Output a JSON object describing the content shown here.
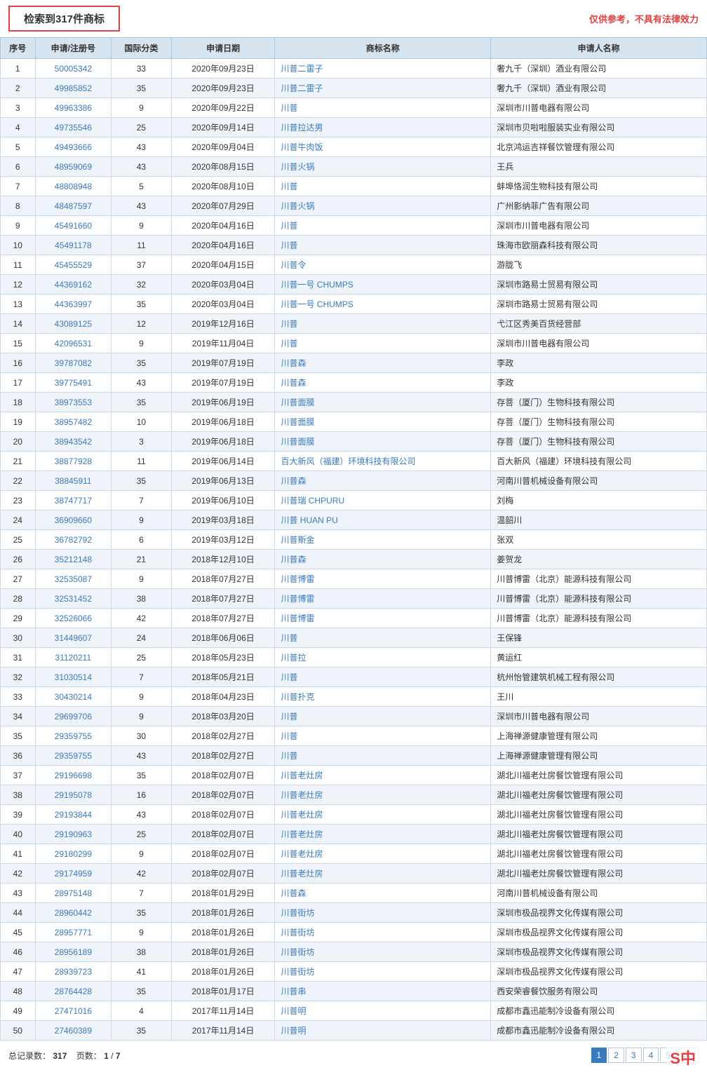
{
  "header": {
    "search_result": "检索到317件商标",
    "disclaimer": "仅供参考，不具有法律效力"
  },
  "table": {
    "columns": [
      "序号",
      "申请/注册号",
      "国际分类",
      "申请日期",
      "商标名称",
      "申请人名称"
    ],
    "rows": [
      {
        "seq": "1",
        "app_no": "50005342",
        "int_class": "33",
        "app_date": "2020年09月23日",
        "tm_name": "川普二雷子",
        "applicant": "奢九千（深圳）酒业有限公司"
      },
      {
        "seq": "2",
        "app_no": "49985852",
        "int_class": "35",
        "app_date": "2020年09月23日",
        "tm_name": "川普二雷子",
        "applicant": "奢九千（深圳）酒业有限公司"
      },
      {
        "seq": "3",
        "app_no": "49963386",
        "int_class": "9",
        "app_date": "2020年09月22日",
        "tm_name": "川普",
        "applicant": "深圳市川普电器有限公司"
      },
      {
        "seq": "4",
        "app_no": "49735546",
        "int_class": "25",
        "app_date": "2020年09月14日",
        "tm_name": "川普拉达男",
        "applicant": "深圳市贝啦啦服装实业有限公司"
      },
      {
        "seq": "5",
        "app_no": "49493666",
        "int_class": "43",
        "app_date": "2020年09月04日",
        "tm_name": "川普牛肉饭",
        "applicant": "北京鸿运吉祥餐饮管理有限公司"
      },
      {
        "seq": "6",
        "app_no": "48959069",
        "int_class": "43",
        "app_date": "2020年08月15日",
        "tm_name": "川普火锅",
        "applicant": "王兵"
      },
      {
        "seq": "7",
        "app_no": "48808948",
        "int_class": "5",
        "app_date": "2020年08月10日",
        "tm_name": "川普",
        "applicant": "蚌埠恪润生物科技有限公司"
      },
      {
        "seq": "8",
        "app_no": "48487597",
        "int_class": "43",
        "app_date": "2020年07月29日",
        "tm_name": "川普火锅",
        "applicant": "广州影纳菲广告有限公司"
      },
      {
        "seq": "9",
        "app_no": "45491660",
        "int_class": "9",
        "app_date": "2020年04月16日",
        "tm_name": "川普",
        "applicant": "深圳市川普电器有限公司"
      },
      {
        "seq": "10",
        "app_no": "45491178",
        "int_class": "11",
        "app_date": "2020年04月16日",
        "tm_name": "川普",
        "applicant": "珠海市欧丽森科技有限公司"
      },
      {
        "seq": "11",
        "app_no": "45455529",
        "int_class": "37",
        "app_date": "2020年04月15日",
        "tm_name": "川普令",
        "applicant": "游胧飞"
      },
      {
        "seq": "12",
        "app_no": "44369162",
        "int_class": "32",
        "app_date": "2020年03月04日",
        "tm_name": "川普一号 CHUMPS",
        "applicant": "深圳市路易士贸易有限公司"
      },
      {
        "seq": "13",
        "app_no": "44363997",
        "int_class": "35",
        "app_date": "2020年03月04日",
        "tm_name": "川普一号 CHUMPS",
        "applicant": "深圳市路易士贸易有限公司"
      },
      {
        "seq": "14",
        "app_no": "43089125",
        "int_class": "12",
        "app_date": "2019年12月16日",
        "tm_name": "川普",
        "applicant": "弋江区秀美百货经营部"
      },
      {
        "seq": "15",
        "app_no": "42096531",
        "int_class": "9",
        "app_date": "2019年11月04日",
        "tm_name": "川普",
        "applicant": "深圳市川普电器有限公司"
      },
      {
        "seq": "16",
        "app_no": "39787082",
        "int_class": "35",
        "app_date": "2019年07月19日",
        "tm_name": "川普森",
        "applicant": "李政"
      },
      {
        "seq": "17",
        "app_no": "39775491",
        "int_class": "43",
        "app_date": "2019年07月19日",
        "tm_name": "川普森",
        "applicant": "李政"
      },
      {
        "seq": "18",
        "app_no": "38973553",
        "int_class": "35",
        "app_date": "2019年06月19日",
        "tm_name": "川普面膜",
        "applicant": "存菩（厦门）生物科技有限公司"
      },
      {
        "seq": "19",
        "app_no": "38957482",
        "int_class": "10",
        "app_date": "2019年06月18日",
        "tm_name": "川普面膜",
        "applicant": "存菩（厦门）生物科技有限公司"
      },
      {
        "seq": "20",
        "app_no": "38943542",
        "int_class": "3",
        "app_date": "2019年06月18日",
        "tm_name": "川普面膜",
        "applicant": "存菩（厦门）生物科技有限公司"
      },
      {
        "seq": "21",
        "app_no": "38877928",
        "int_class": "11",
        "app_date": "2019年06月14日",
        "tm_name": "百大新风（福建）环境科技有限公司",
        "applicant": "百大新风（福建）环境科技有限公司"
      },
      {
        "seq": "22",
        "app_no": "38845911",
        "int_class": "35",
        "app_date": "2019年06月13日",
        "tm_name": "川普森",
        "applicant": "河南川普机械设备有限公司"
      },
      {
        "seq": "23",
        "app_no": "38747717",
        "int_class": "7",
        "app_date": "2019年06月10日",
        "tm_name": "川普瑞 CHPURU",
        "applicant": "刘梅"
      },
      {
        "seq": "24",
        "app_no": "36909660",
        "int_class": "9",
        "app_date": "2019年03月18日",
        "tm_name": "川普 HUAN PU",
        "applicant": "温韶川"
      },
      {
        "seq": "25",
        "app_no": "36782792",
        "int_class": "6",
        "app_date": "2019年03月12日",
        "tm_name": "川普斯金",
        "applicant": "张双"
      },
      {
        "seq": "26",
        "app_no": "35212148",
        "int_class": "21",
        "app_date": "2018年12月10日",
        "tm_name": "川普森",
        "applicant": "姜贺龙"
      },
      {
        "seq": "27",
        "app_no": "32535087",
        "int_class": "9",
        "app_date": "2018年07月27日",
        "tm_name": "川普博雷",
        "applicant": "川普博雷（北京）能源科技有限公司"
      },
      {
        "seq": "28",
        "app_no": "32531452",
        "int_class": "38",
        "app_date": "2018年07月27日",
        "tm_name": "川普博雷",
        "applicant": "川普博雷（北京）能源科技有限公司"
      },
      {
        "seq": "29",
        "app_no": "32526066",
        "int_class": "42",
        "app_date": "2018年07月27日",
        "tm_name": "川普博雷",
        "applicant": "川普博雷（北京）能源科技有限公司"
      },
      {
        "seq": "30",
        "app_no": "31449607",
        "int_class": "24",
        "app_date": "2018年06月06日",
        "tm_name": "川普",
        "applicant": "王保锋"
      },
      {
        "seq": "31",
        "app_no": "31120211",
        "int_class": "25",
        "app_date": "2018年05月23日",
        "tm_name": "川普拉",
        "applicant": "黄运红"
      },
      {
        "seq": "32",
        "app_no": "31030514",
        "int_class": "7",
        "app_date": "2018年05月21日",
        "tm_name": "川普",
        "applicant": "杭州怡管建筑机械工程有限公司"
      },
      {
        "seq": "33",
        "app_no": "30430214",
        "int_class": "9",
        "app_date": "2018年04月23日",
        "tm_name": "川普扑克",
        "applicant": "王川"
      },
      {
        "seq": "34",
        "app_no": "29699706",
        "int_class": "9",
        "app_date": "2018年03月20日",
        "tm_name": "川普",
        "applicant": "深圳市川普电器有限公司"
      },
      {
        "seq": "35",
        "app_no": "29359755",
        "int_class": "30",
        "app_date": "2018年02月27日",
        "tm_name": "川普",
        "applicant": "上海禅源健康管理有限公司"
      },
      {
        "seq": "36",
        "app_no": "29359755",
        "int_class": "43",
        "app_date": "2018年02月27日",
        "tm_name": "川普",
        "applicant": "上海禅源健康管理有限公司"
      },
      {
        "seq": "37",
        "app_no": "29196698",
        "int_class": "35",
        "app_date": "2018年02月07日",
        "tm_name": "川普老灶房",
        "applicant": "湖北川福老灶房餐饮管理有限公司"
      },
      {
        "seq": "38",
        "app_no": "29195078",
        "int_class": "16",
        "app_date": "2018年02月07日",
        "tm_name": "川普老灶房",
        "applicant": "湖北川福老灶房餐饮管理有限公司"
      },
      {
        "seq": "39",
        "app_no": "29193844",
        "int_class": "43",
        "app_date": "2018年02月07日",
        "tm_name": "川普老灶房",
        "applicant": "湖北川福老灶房餐饮管理有限公司"
      },
      {
        "seq": "40",
        "app_no": "29190963",
        "int_class": "25",
        "app_date": "2018年02月07日",
        "tm_name": "川普老灶房",
        "applicant": "湖北川福老灶房餐饮管理有限公司"
      },
      {
        "seq": "41",
        "app_no": "29180299",
        "int_class": "9",
        "app_date": "2018年02月07日",
        "tm_name": "川普老灶房",
        "applicant": "湖北川福老灶房餐饮管理有限公司"
      },
      {
        "seq": "42",
        "app_no": "29174959",
        "int_class": "42",
        "app_date": "2018年02月07日",
        "tm_name": "川普老灶房",
        "applicant": "湖北川福老灶房餐饮管理有限公司"
      },
      {
        "seq": "43",
        "app_no": "28975148",
        "int_class": "7",
        "app_date": "2018年01月29日",
        "tm_name": "川普森",
        "applicant": "河南川普机械设备有限公司"
      },
      {
        "seq": "44",
        "app_no": "28960442",
        "int_class": "35",
        "app_date": "2018年01月26日",
        "tm_name": "川普街坊",
        "applicant": "深圳市极品视界文化传媒有限公司"
      },
      {
        "seq": "45",
        "app_no": "28957771",
        "int_class": "9",
        "app_date": "2018年01月26日",
        "tm_name": "川普街坊",
        "applicant": "深圳市极品视界文化传媒有限公司"
      },
      {
        "seq": "46",
        "app_no": "28956189",
        "int_class": "38",
        "app_date": "2018年01月26日",
        "tm_name": "川普街坊",
        "applicant": "深圳市极品视界文化传媒有限公司"
      },
      {
        "seq": "47",
        "app_no": "28939723",
        "int_class": "41",
        "app_date": "2018年01月26日",
        "tm_name": "川普街坊",
        "applicant": "深圳市极品视界文化传媒有限公司"
      },
      {
        "seq": "48",
        "app_no": "28764428",
        "int_class": "35",
        "app_date": "2018年01月17日",
        "tm_name": "川普串",
        "applicant": "西安荣睿餐饮服务有限公司"
      },
      {
        "seq": "49",
        "app_no": "27471016",
        "int_class": "4",
        "app_date": "2017年11月14日",
        "tm_name": "川普明",
        "applicant": "成都市鑫迅能制冷设备有限公司"
      },
      {
        "seq": "50",
        "app_no": "27460389",
        "int_class": "35",
        "app_date": "2017年11月14日",
        "tm_name": "川普明",
        "applicant": "成都市鑫迅能制冷设备有限公司"
      }
    ]
  },
  "footer": {
    "total_label": "总记录数：",
    "total_count": "317",
    "page_label": "页数：",
    "current_page": "1",
    "total_pages": "7"
  },
  "pagination": {
    "buttons": [
      "1",
      "2",
      "3",
      "4",
      "5",
      ">>"
    ]
  },
  "watermark": "S中"
}
